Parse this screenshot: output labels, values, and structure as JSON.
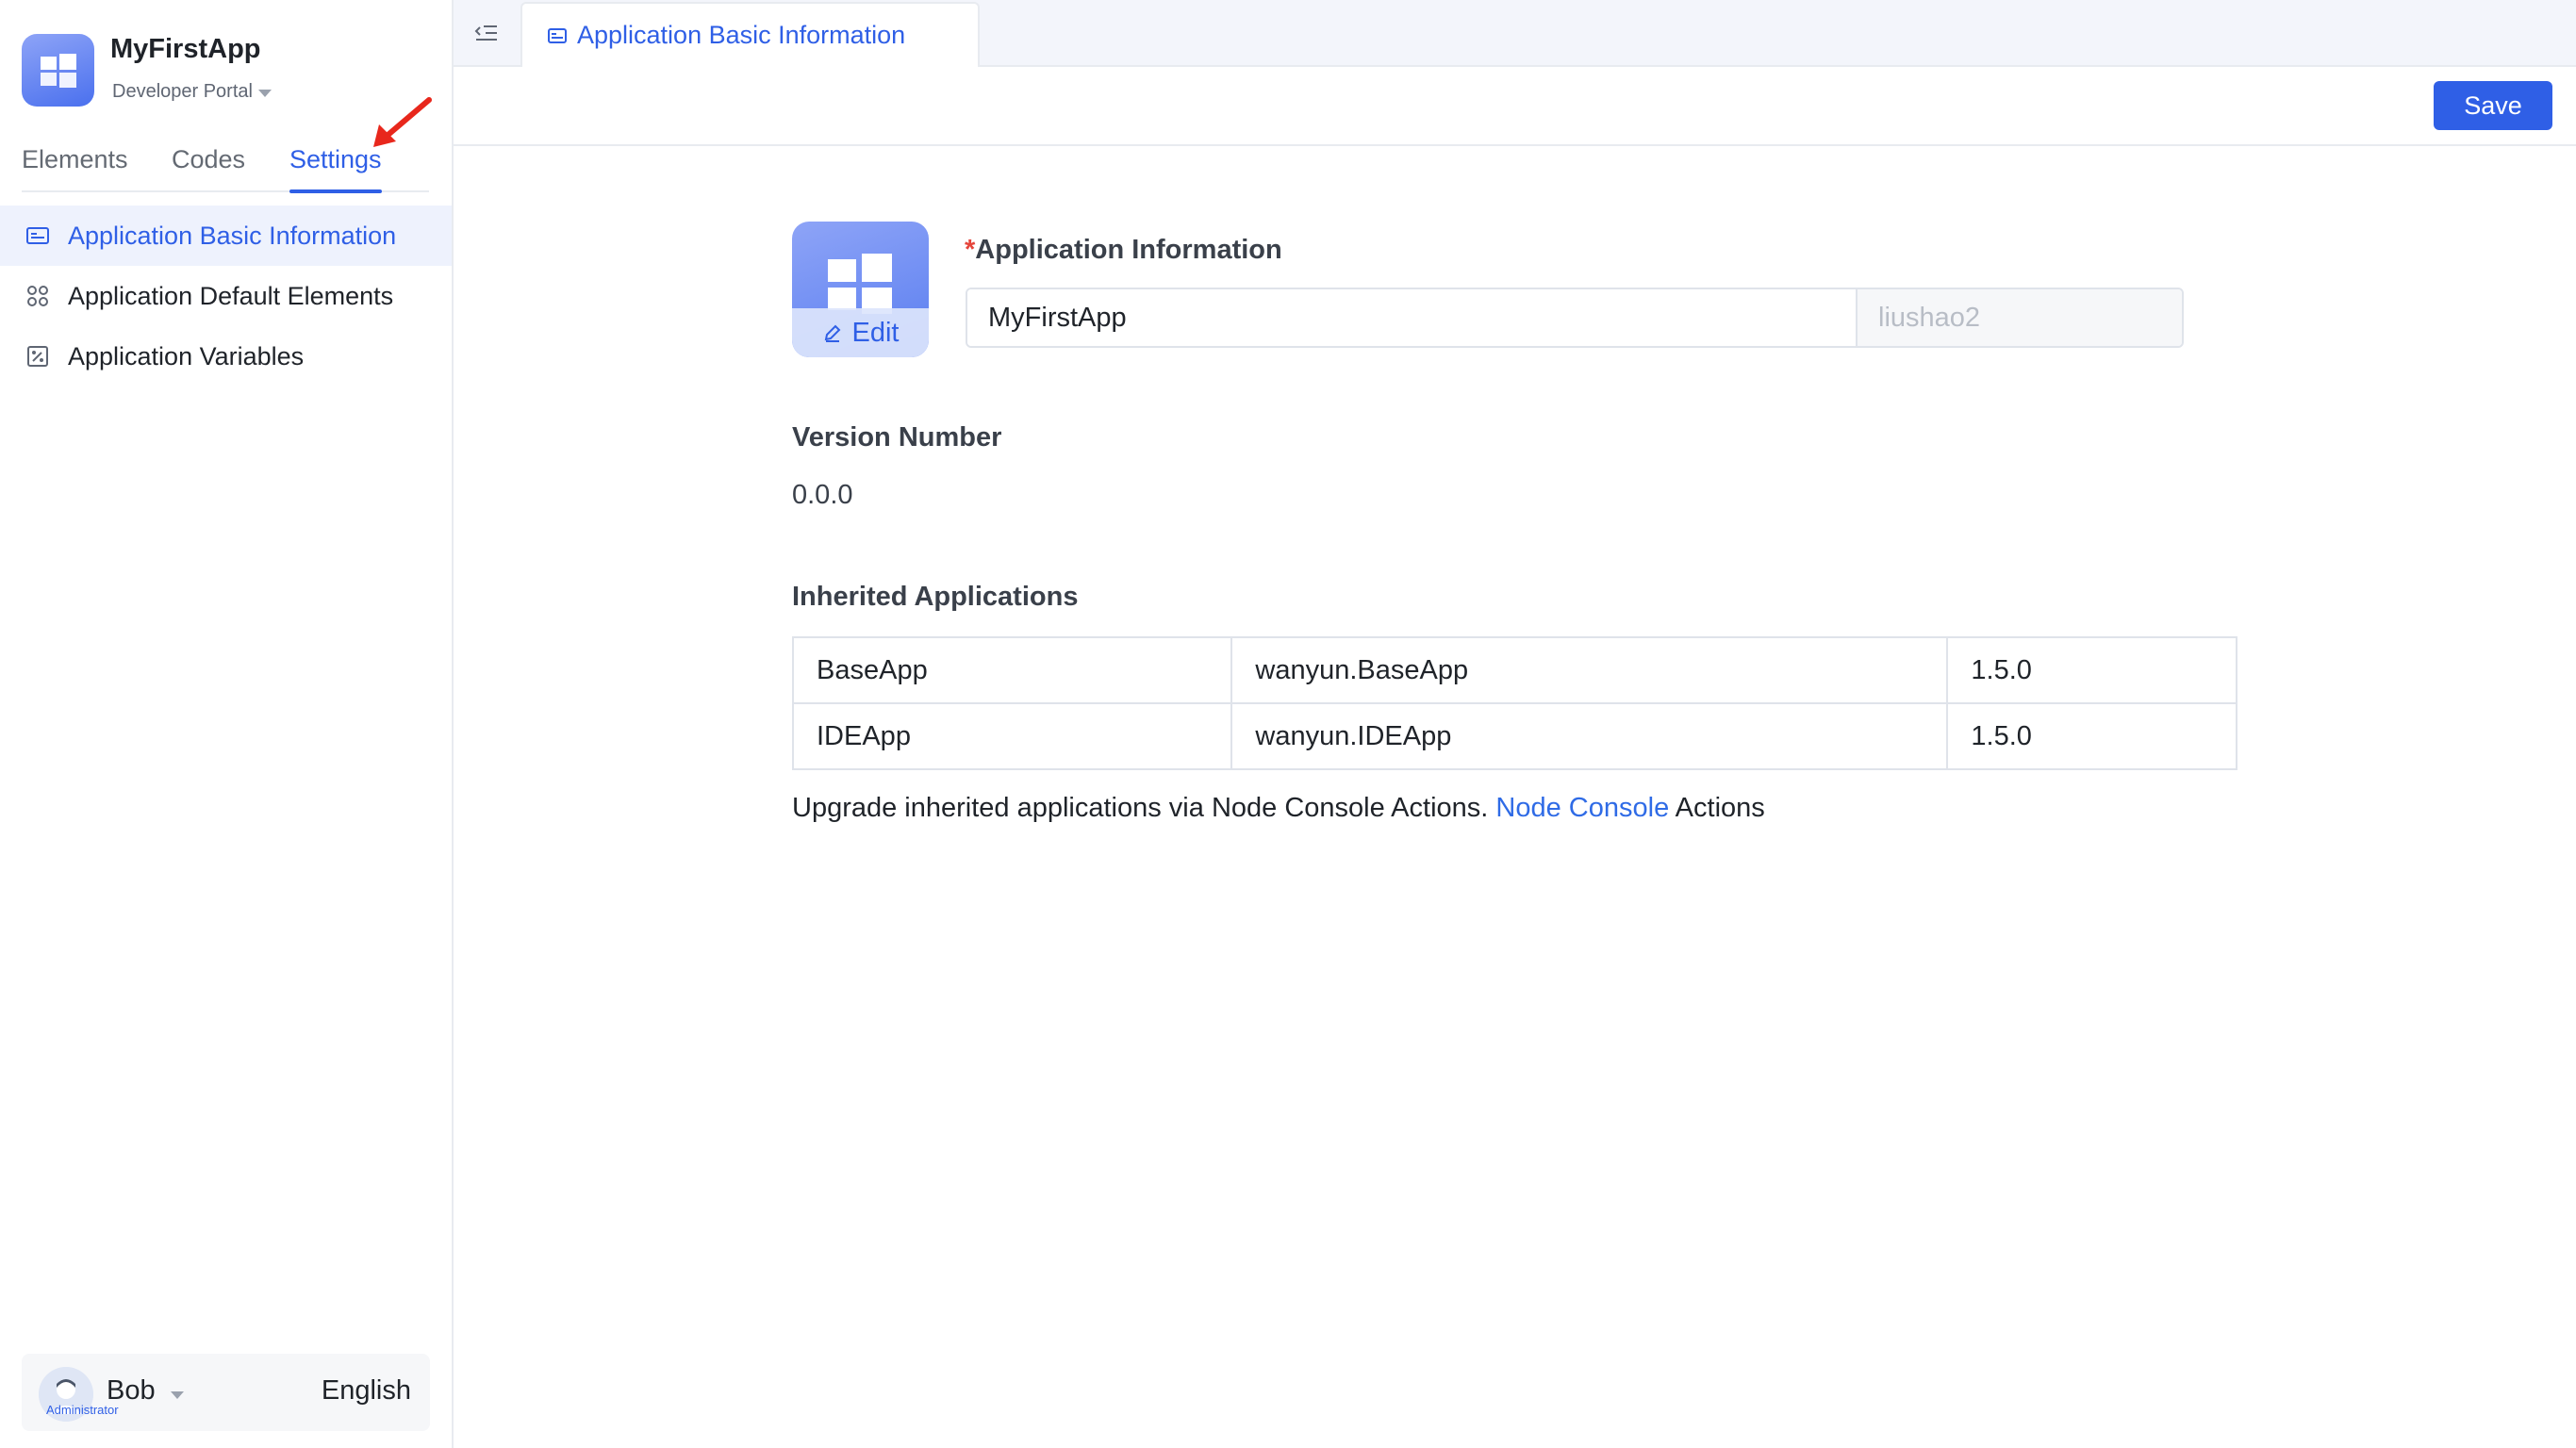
{
  "app": {
    "name": "MyFirstApp",
    "portal": "Developer Portal",
    "brand_color": "#2f5fe6"
  },
  "sidebar": {
    "tabs": [
      {
        "label": "Elements",
        "active": false
      },
      {
        "label": "Codes",
        "active": false
      },
      {
        "label": "Settings",
        "active": true
      }
    ],
    "items": [
      {
        "label": "Application Basic Information",
        "icon": "id-card-icon",
        "active": true
      },
      {
        "label": "Application Default Elements",
        "icon": "grid-dots-icon",
        "active": false
      },
      {
        "label": "Application Variables",
        "icon": "variable-icon",
        "active": false
      }
    ]
  },
  "user": {
    "name": "Bob",
    "role": "Administrator",
    "language": "English"
  },
  "topbar": {
    "tab_label": "Application Basic Information"
  },
  "toolbar": {
    "save_label": "Save"
  },
  "form": {
    "icon_edit_label": "Edit",
    "app_info_label": "Application Information",
    "app_name_value": "MyFirstApp",
    "app_owner_value": "liushao2",
    "version_label": "Version Number",
    "version_value": "0.0.0",
    "inherited_label": "Inherited Applications",
    "inherited_apps": [
      {
        "name": "BaseApp",
        "full_name": "wanyun.BaseApp",
        "version": "1.5.0"
      },
      {
        "name": "IDEApp",
        "full_name": "wanyun.IDEApp",
        "version": "1.5.0"
      }
    ],
    "upgrade_note_prefix": "Upgrade inherited applications via Node Console Actions.",
    "upgrade_note_link": "Node Console",
    "upgrade_note_suffix": "Actions"
  }
}
